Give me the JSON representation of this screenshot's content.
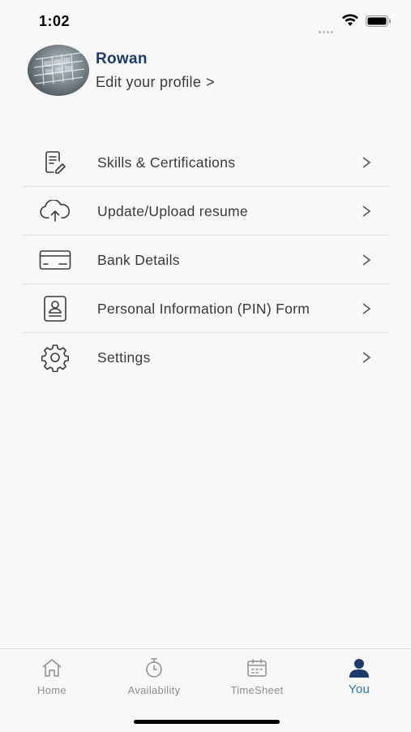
{
  "status_bar": {
    "time": "1:02"
  },
  "profile": {
    "name": "Rowan",
    "edit_label": "Edit your profile",
    "edit_chevron": ">"
  },
  "menu": {
    "items": [
      {
        "label": "Skills & Certifications",
        "icon": "document-edit-icon",
        "chevron": ">"
      },
      {
        "label": "Update/Upload resume",
        "icon": "cloud-upload-icon",
        "chevron": ">"
      },
      {
        "label": "Bank Details",
        "icon": "credit-card-icon",
        "chevron": ">"
      },
      {
        "label": "Personal Information (PIN) Form",
        "icon": "id-badge-icon",
        "chevron": ">"
      },
      {
        "label": "Settings",
        "icon": "gear-icon",
        "chevron": ">"
      }
    ]
  },
  "tab_bar": {
    "tabs": [
      {
        "label": "Home",
        "icon": "home-icon"
      },
      {
        "label": "Availability",
        "icon": "timer-icon"
      },
      {
        "label": "TimeSheet",
        "icon": "calendar-icon"
      },
      {
        "label": "You",
        "icon": "person-icon",
        "active": true
      }
    ]
  },
  "colors": {
    "accent": "#2c6fb5",
    "name": "#1f3b6e",
    "background": "#f8f8f9",
    "text": "#3a3a3c",
    "inactive": "#8e8e93"
  }
}
